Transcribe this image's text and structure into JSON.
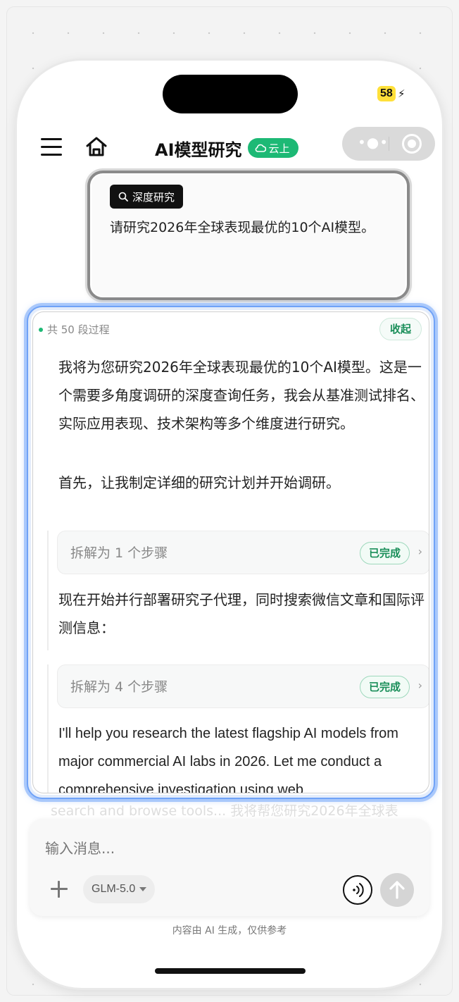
{
  "status_bar": {
    "battery": "58",
    "battery_icon": "bolt-icon"
  },
  "nav": {
    "title": "AI模型研究",
    "badge": "云上",
    "menu_icon": "hamburger-icon",
    "home_icon": "home-icon",
    "capsule_icons": [
      "more-dots-icon",
      "close-target-icon"
    ]
  },
  "user_message": {
    "tag": "深度研究",
    "text": "请研究2026年全球表现最优的10个AI模型。"
  },
  "process": {
    "count_label": "共 50 段过程",
    "collapse_label": "收起",
    "paragraphs": [
      "我将为您研究2026年全球表现最优的10个AI模型。这是一个需要多角度调研的深度查询任务，我会从基准测试排名、实际应用表现、技术架构等多个维度进行研究。",
      "首先，让我制定详细的研究计划并开始调研。",
      "现在开始并行部署研究子代理，同时搜索微信文章和国际评测信息：",
      "I'll help you research the latest flagship AI models from major commercial AI labs in 2026. Let me conduct a comprehensive investigation using web"
    ],
    "steps": [
      {
        "label": "拆解为 1 个步骤",
        "status": "已完成"
      },
      {
        "label": "拆解为 4 个步骤",
        "status": "已完成"
      }
    ],
    "faded_tail": "search and browse tools... 我将帮您研究2026年全球表"
  },
  "composer": {
    "placeholder": "输入消息...",
    "model": "GLM-5.0",
    "footnote": "内容由 AI 生成，仅供参考"
  },
  "colors": {
    "accent_green": "#1db975",
    "highlight_blue": "#6fa2f7",
    "battery_yellow": "#ffe03a"
  }
}
